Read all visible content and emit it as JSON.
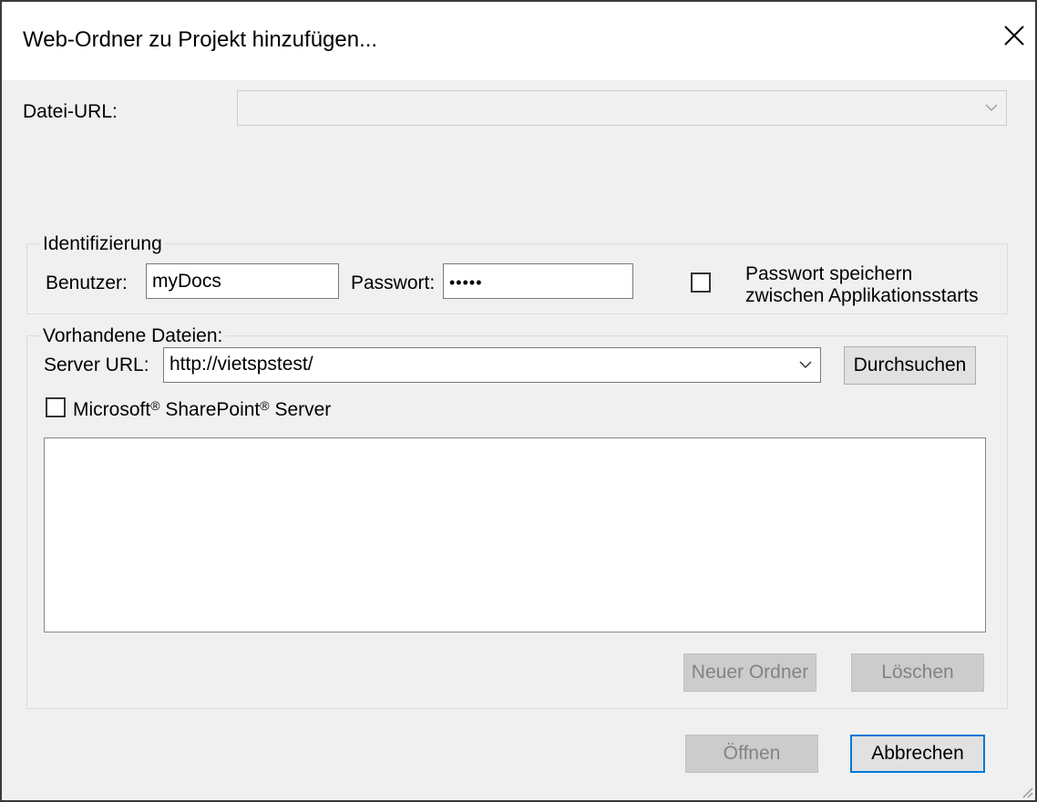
{
  "window": {
    "title": "Web-Ordner zu Projekt hinzufügen...",
    "close_icon": "close-icon"
  },
  "file_url": {
    "label": "Datei-URL:",
    "value": ""
  },
  "identification": {
    "group_title": "Identifizierung",
    "user_label": "Benutzer:",
    "user_value": "myDocs",
    "password_label": "Passwort:",
    "password_value": "•••••",
    "save_password_label_line1": "Passwort speichern",
    "save_password_label_line2": "zwischen Applikationsstarts",
    "save_password_checked": false
  },
  "existing_files": {
    "group_title": "Vorhandene Dateien:",
    "server_url_label": "Server URL:",
    "server_url_value": "http://vietspstest/",
    "browse_label": "Durchsuchen",
    "sharepoint_label_part1": "Microsoft",
    "sharepoint_label_part2": "SharePoint",
    "sharepoint_label_part3": "Server",
    "registered_mark": "®",
    "sharepoint_checked": false,
    "new_folder_label": "Neuer Ordner",
    "delete_label": "Löschen"
  },
  "footer": {
    "open_label": "Öffnen",
    "cancel_label": "Abbrechen"
  },
  "colors": {
    "dialog_bg": "#f0f0f0",
    "titlebar_bg": "#ffffff",
    "default_button_border": "#0078d7"
  }
}
